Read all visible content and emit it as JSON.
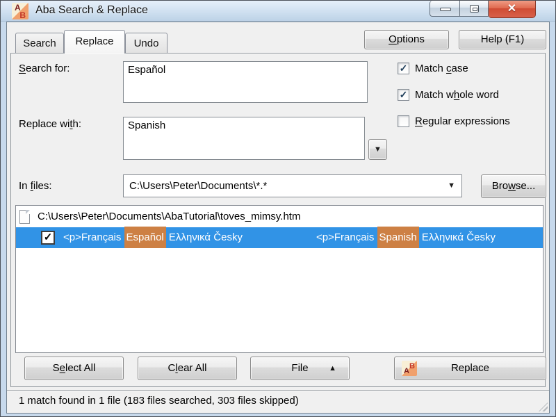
{
  "window": {
    "title": "Aba Search & Replace",
    "icon": {
      "letter_a": "A",
      "letter_b": "B"
    },
    "controls": {
      "close_glyph": "✕"
    }
  },
  "tabs": [
    {
      "label": "Search"
    },
    {
      "label": "Replace",
      "active": true
    },
    {
      "label": "Undo"
    }
  ],
  "header": {
    "options": {
      "pre": "",
      "key": "O",
      "post": "ptions"
    },
    "help": {
      "label": "Help (F1)"
    }
  },
  "form": {
    "search_for": {
      "label": {
        "pre": "",
        "key": "S",
        "post": "earch for:"
      },
      "value": "Español"
    },
    "replace_with": {
      "label": {
        "pre": "Replace wi",
        "key": "t",
        "post": "h:"
      },
      "value": "Spanish"
    },
    "history_button": {
      "glyph": "▼"
    },
    "options": [
      {
        "label": {
          "pre": "Match ",
          "key": "c",
          "post": "ase"
        },
        "checked": true,
        "glyph": "✓"
      },
      {
        "label": {
          "pre": "Match w",
          "key": "h",
          "post": "ole word"
        },
        "checked": true,
        "glyph": "✓"
      },
      {
        "label": {
          "pre": "",
          "key": "R",
          "post": "egular expressions"
        },
        "checked": false,
        "glyph": ""
      }
    ],
    "in_files": {
      "label": {
        "pre": "In ",
        "key": "f",
        "post": "iles:"
      },
      "value": "C:\\Users\\Peter\\Documents\\*.*",
      "arrow": "▼",
      "browse": {
        "pre": "Bro",
        "key": "w",
        "post": "se..."
      }
    }
  },
  "results": {
    "file_path": "C:\\Users\\Peter\\Documents\\AbaTutorial\\toves_mimsy.htm",
    "match": {
      "checked": true,
      "glyph": "✓",
      "before": {
        "prefix": "<p>Français ",
        "match": "Español",
        "suffix": " Ελληνικά Česky"
      },
      "after": {
        "prefix": "<p>Français ",
        "match": "Spanish",
        "suffix": " Ελληνικά Česky"
      }
    }
  },
  "actions": {
    "select_all": {
      "pre": "S",
      "key": "e",
      "post": "lect All"
    },
    "clear_all": {
      "pre": "C",
      "key": "l",
      "post": "ear All"
    },
    "file": {
      "label": "File",
      "arrow": "▲"
    },
    "replace": {
      "label": "Replace"
    }
  },
  "status": {
    "text": "1 match found in 1 file (183 files searched, 303 files skipped)"
  },
  "colors": {
    "selection_blue": "#3193e6",
    "match_highlight": "#cd8044",
    "close_button_red": "#d0523f",
    "icon_cream": "#f8efd6",
    "icon_orange": "#f0a06c",
    "titlebar_blue": "#cfe0f0"
  }
}
